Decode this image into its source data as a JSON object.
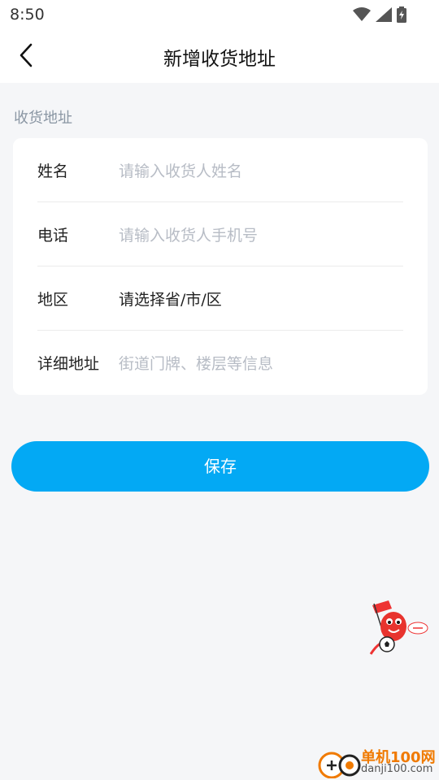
{
  "status_bar": {
    "time": "8:50"
  },
  "header": {
    "title": "新增收货地址"
  },
  "section": {
    "label": "收货地址"
  },
  "form": {
    "rows": [
      {
        "label": "姓名",
        "value": "请输入收货人姓名"
      },
      {
        "label": "电话",
        "value": "请输入收货人手机号"
      },
      {
        "label": "地区",
        "value": "请选择省/市/区"
      },
      {
        "label": "详细地址",
        "value": "街道门牌、楼层等信息"
      }
    ]
  },
  "save_button": {
    "label": "保存"
  },
  "watermark": {
    "line1": "单机100网",
    "line2": "danji100.com"
  },
  "colors": {
    "accent": "#03a9f4",
    "placeholder": "#b7bcc5",
    "background": "#f5f6f8"
  }
}
